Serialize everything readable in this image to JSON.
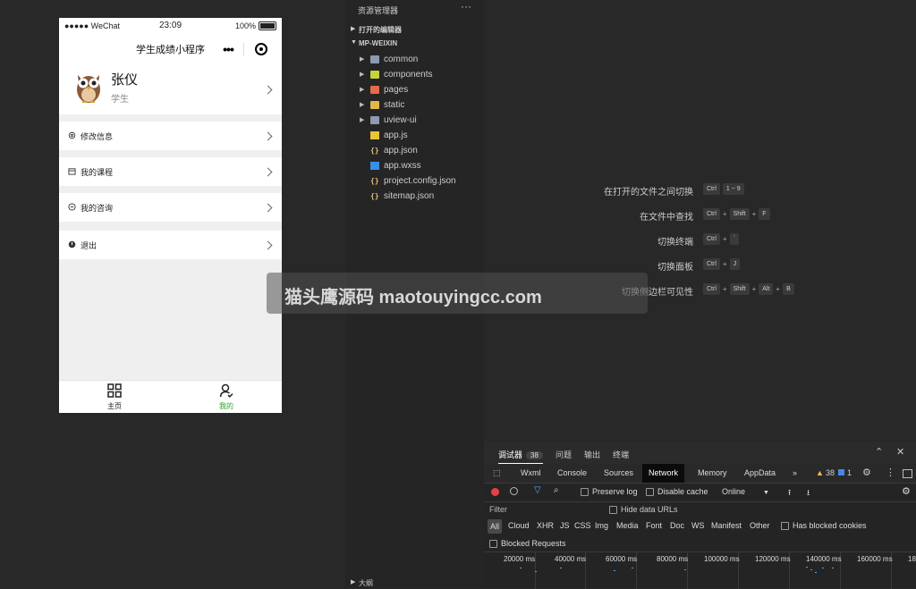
{
  "phone": {
    "status_bar": {
      "signal": "●●●●● WeChat",
      "time": "23:09",
      "battery": "100%"
    },
    "navbar": {
      "title": "学生成绩小程序",
      "more_icon": "ellipsis-icon",
      "close_icon": "target-icon"
    },
    "profile": {
      "name": "张仪",
      "role": "学生"
    },
    "menu": [
      {
        "label": "修改信息",
        "icon": "settings-icon"
      },
      {
        "label": "我的课程",
        "icon": "calendar-icon"
      },
      {
        "label": "我的咨询",
        "icon": "chat-icon"
      },
      {
        "label": "退出",
        "icon": "exit-icon"
      }
    ],
    "tabbar": [
      {
        "label": "主页",
        "icon": "grid-icon"
      },
      {
        "label": "我的",
        "icon": "user-icon"
      }
    ]
  },
  "explorer": {
    "title": "资源管理器",
    "more": "···",
    "open_editors": "打开的编辑器",
    "project": "MP-WEIXIN",
    "files": [
      {
        "name": "common",
        "type": "folder"
      },
      {
        "name": "components",
        "type": "folder"
      },
      {
        "name": "pages",
        "type": "folder"
      },
      {
        "name": "static",
        "type": "folder"
      },
      {
        "name": "uview-ui",
        "type": "folder"
      },
      {
        "name": "app.js",
        "type": "js"
      },
      {
        "name": "app.json",
        "type": "json"
      },
      {
        "name": "app.wxss",
        "type": "css"
      },
      {
        "name": "project.config.json",
        "type": "json"
      },
      {
        "name": "sitemap.json",
        "type": "json"
      }
    ],
    "outline": "大纲"
  },
  "shortcuts": [
    {
      "desc": "在打开的文件之间切换",
      "keys": [
        "Ctrl",
        "1 ~ 9"
      ]
    },
    {
      "desc": "在文件中查找",
      "keys": [
        "Ctrl",
        "Shift",
        "F"
      ]
    },
    {
      "desc": "切换终端",
      "keys": [
        "Ctrl",
        "`"
      ]
    },
    {
      "desc": "切换面板",
      "keys": [
        "Ctrl",
        "J"
      ]
    },
    {
      "desc": "切换侧边栏可见性",
      "keys": [
        "Ctrl",
        "Shift",
        "Alt",
        "B"
      ]
    }
  ],
  "watermark": {
    "text": "猫头鹰源码 maotouyingcc.com"
  },
  "devtools": {
    "top_tabs": {
      "debugger": "调试器",
      "count": "38",
      "issues": "问题",
      "output": "输出",
      "terminal": "终端"
    },
    "panel_tabs": [
      "Wxml",
      "Console",
      "Sources",
      "Network",
      "Memory",
      "AppData"
    ],
    "more_tabs": "»",
    "warn_count": "38",
    "info_count": "1",
    "preserve_log": "Preserve log",
    "disable_cache": "Disable cache",
    "throttle": "Online",
    "filter_placeholder": "Filter",
    "hide_data_urls": "Hide data URLs",
    "types": [
      "All",
      "Cloud",
      "XHR",
      "JS",
      "CSS",
      "Img",
      "Media",
      "Font",
      "Doc",
      "WS",
      "Manifest",
      "Other"
    ],
    "has_blocked_cookies": "Has blocked cookies",
    "blocked_requests": "Blocked Requests",
    "timeline_ticks": [
      "20000 ms",
      "40000 ms",
      "60000 ms",
      "80000 ms",
      "100000 ms",
      "120000 ms",
      "140000 ms",
      "160000 ms",
      "18"
    ]
  },
  "colors": {
    "active_tab": "#2aa12a",
    "record": "#e84040",
    "filter": "#4fa3ff"
  }
}
